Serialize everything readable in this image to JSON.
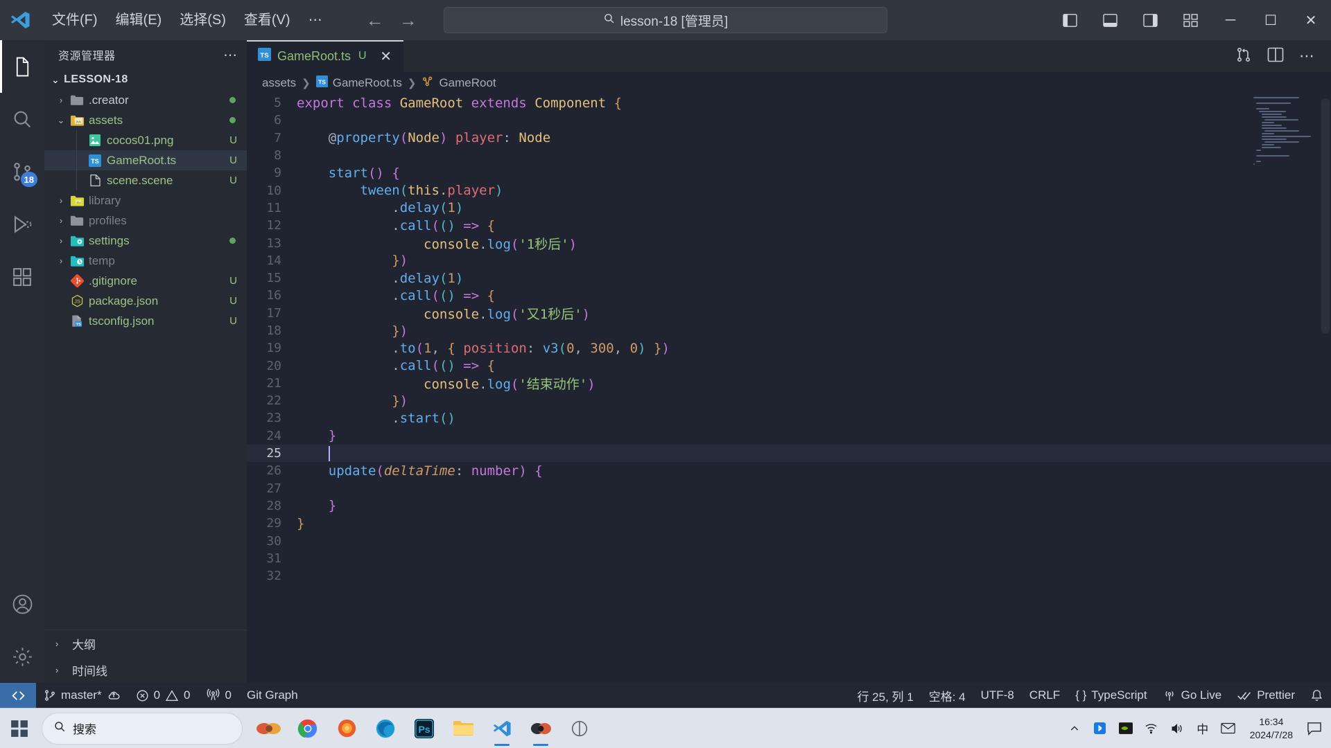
{
  "titlebar": {
    "menus": [
      "文件(F)",
      "编辑(E)",
      "选择(S)",
      "查看(V)",
      "⋯"
    ],
    "back_icon": "←",
    "forward_icon": "→",
    "command_center_text": "lesson-18 [管理员]",
    "search_icon": "search-icon",
    "minimize": "─",
    "maximize": "☐",
    "close": "✕"
  },
  "activitybar": {
    "items": [
      {
        "name": "explorer",
        "icon": "files-icon",
        "active": true,
        "badge": ""
      },
      {
        "name": "search",
        "icon": "search-icon",
        "active": false,
        "badge": ""
      },
      {
        "name": "source-control",
        "icon": "source-control-icon",
        "active": false,
        "badge": "18"
      },
      {
        "name": "run-and-debug",
        "icon": "run-debug-icon",
        "active": false,
        "badge": ""
      },
      {
        "name": "extensions",
        "icon": "extensions-icon",
        "active": false,
        "badge": ""
      }
    ],
    "bottom": [
      {
        "name": "accounts",
        "icon": "account-icon"
      },
      {
        "name": "manage",
        "icon": "gear-icon"
      }
    ]
  },
  "sidebar": {
    "title": "资源管理器",
    "actions_icon": "⋯",
    "root_label": "LESSON-18",
    "root_twisty": "⌄",
    "tree": [
      {
        "label": ".creator",
        "icon": "folder-plain",
        "twisty": "›",
        "depth": 1,
        "badge": "",
        "dot": true,
        "dim": false,
        "selected": false,
        "color": "#c7cbd2"
      },
      {
        "label": "assets",
        "icon": "folder-assets",
        "twisty": "⌄",
        "depth": 1,
        "badge": "",
        "dot": true,
        "dim": false,
        "selected": false,
        "color": "#9ec287"
      },
      {
        "label": "cocos01.png",
        "icon": "file-image",
        "twisty": "",
        "depth": 2,
        "badge": "U",
        "dot": false,
        "dim": false,
        "selected": false,
        "color": "#9ec287"
      },
      {
        "label": "GameRoot.ts",
        "icon": "file-ts",
        "twisty": "",
        "depth": 2,
        "badge": "U",
        "dot": false,
        "dim": false,
        "selected": true,
        "color": "#9ec287"
      },
      {
        "label": "scene.scene",
        "icon": "file-plain",
        "twisty": "",
        "depth": 2,
        "badge": "U",
        "dot": false,
        "dim": false,
        "selected": false,
        "color": "#9ec287"
      },
      {
        "label": "library",
        "icon": "folder-yellow",
        "twisty": "›",
        "depth": 1,
        "badge": "",
        "dot": false,
        "dim": true,
        "selected": false,
        "color": "#7d828a"
      },
      {
        "label": "profiles",
        "icon": "folder-plain",
        "twisty": "›",
        "depth": 1,
        "badge": "",
        "dot": false,
        "dim": true,
        "selected": false,
        "color": "#7d828a"
      },
      {
        "label": "settings",
        "icon": "folder-gear",
        "twisty": "›",
        "depth": 1,
        "badge": "",
        "dot": true,
        "dim": false,
        "selected": false,
        "color": "#9ec287"
      },
      {
        "label": "temp",
        "icon": "folder-clock",
        "twisty": "›",
        "depth": 1,
        "badge": "",
        "dot": false,
        "dim": true,
        "selected": false,
        "color": "#7d828a"
      },
      {
        "label": ".gitignore",
        "icon": "file-git",
        "twisty": "",
        "depth": 1,
        "badge": "U",
        "dot": false,
        "dim": false,
        "selected": false,
        "color": "#9ec287"
      },
      {
        "label": "package.json",
        "icon": "file-js",
        "twisty": "",
        "depth": 1,
        "badge": "U",
        "dot": false,
        "dim": false,
        "selected": false,
        "color": "#9ec287"
      },
      {
        "label": "tsconfig.json",
        "icon": "file-tsconfig",
        "twisty": "",
        "depth": 1,
        "badge": "U",
        "dot": false,
        "dim": false,
        "selected": false,
        "color": "#9ec287"
      }
    ],
    "panels": [
      {
        "label": "大纲",
        "twisty": "›"
      },
      {
        "label": "时间线",
        "twisty": "›"
      }
    ]
  },
  "editor": {
    "tab": {
      "icon": "file-ts",
      "label": "GameRoot.ts",
      "badge": "U",
      "close": "✕"
    },
    "tab_actions": [
      "split-compare-icon",
      "split-editor-icon",
      "more-actions-icon"
    ],
    "breadcrumbs": [
      {
        "label": "assets",
        "icon": ""
      },
      {
        "label": "GameRoot.ts",
        "icon": "file-ts"
      },
      {
        "label": "GameRoot",
        "icon": "class-icon"
      }
    ],
    "first_line_number": 5,
    "current_line": 25,
    "lines": [
      {
        "n": 5,
        "tokens": [
          {
            "t": "export ",
            "c": "t-kw"
          },
          {
            "t": "class ",
            "c": "t-kw"
          },
          {
            "t": "GameRoot ",
            "c": "t-type"
          },
          {
            "t": "extends ",
            "c": "t-kw"
          },
          {
            "t": "Component ",
            "c": "t-type"
          },
          {
            "t": "{",
            "c": "t-paren3"
          }
        ],
        "indent": 0
      },
      {
        "n": 6,
        "tokens": [],
        "indent": 0
      },
      {
        "n": 7,
        "tokens": [
          {
            "t": "@",
            "c": "t-deco"
          },
          {
            "t": "property",
            "c": "t-fn"
          },
          {
            "t": "(",
            "c": "t-paren2"
          },
          {
            "t": "Node",
            "c": "t-type"
          },
          {
            "t": ")",
            "c": "t-paren2"
          },
          {
            "t": " ",
            "c": "t-plain"
          },
          {
            "t": "player",
            "c": "t-prop"
          },
          {
            "t": ": ",
            "c": "t-plain"
          },
          {
            "t": "Node",
            "c": "t-type"
          }
        ],
        "indent": 1
      },
      {
        "n": 8,
        "tokens": [],
        "indent": 1
      },
      {
        "n": 9,
        "tokens": [
          {
            "t": "start",
            "c": "t-fn"
          },
          {
            "t": "()",
            "c": "t-paren2"
          },
          {
            "t": " ",
            "c": "t-plain"
          },
          {
            "t": "{",
            "c": "t-paren2"
          }
        ],
        "indent": 1
      },
      {
        "n": 10,
        "tokens": [
          {
            "t": "tween",
            "c": "t-fn"
          },
          {
            "t": "(",
            "c": "t-paren"
          },
          {
            "t": "this",
            "c": "t-var"
          },
          {
            "t": ".",
            "c": "t-plain"
          },
          {
            "t": "player",
            "c": "t-prop"
          },
          {
            "t": ")",
            "c": "t-paren"
          }
        ],
        "indent": 2
      },
      {
        "n": 11,
        "tokens": [
          {
            "t": ".",
            "c": "t-plain"
          },
          {
            "t": "delay",
            "c": "t-fn"
          },
          {
            "t": "(",
            "c": "t-paren"
          },
          {
            "t": "1",
            "c": "t-num"
          },
          {
            "t": ")",
            "c": "t-paren"
          }
        ],
        "indent": 3
      },
      {
        "n": 12,
        "tokens": [
          {
            "t": ".",
            "c": "t-plain"
          },
          {
            "t": "call",
            "c": "t-fn"
          },
          {
            "t": "(",
            "c": "t-paren2"
          },
          {
            "t": "()",
            "c": "t-paren"
          },
          {
            "t": " ",
            "c": "t-plain"
          },
          {
            "t": "=>",
            "c": "t-arrow"
          },
          {
            "t": " ",
            "c": "t-plain"
          },
          {
            "t": "{",
            "c": "t-paren3"
          }
        ],
        "indent": 3
      },
      {
        "n": 13,
        "tokens": [
          {
            "t": "console",
            "c": "t-type"
          },
          {
            "t": ".",
            "c": "t-plain"
          },
          {
            "t": "log",
            "c": "t-fn"
          },
          {
            "t": "(",
            "c": "t-paren2"
          },
          {
            "t": "'1秒后'",
            "c": "t-str"
          },
          {
            "t": ")",
            "c": "t-paren2"
          }
        ],
        "indent": 4
      },
      {
        "n": 14,
        "tokens": [
          {
            "t": "}",
            "c": "t-paren3"
          },
          {
            "t": ")",
            "c": "t-paren2"
          }
        ],
        "indent": 3
      },
      {
        "n": 15,
        "tokens": [
          {
            "t": ".",
            "c": "t-plain"
          },
          {
            "t": "delay",
            "c": "t-fn"
          },
          {
            "t": "(",
            "c": "t-paren"
          },
          {
            "t": "1",
            "c": "t-num"
          },
          {
            "t": ")",
            "c": "t-paren"
          }
        ],
        "indent": 3
      },
      {
        "n": 16,
        "tokens": [
          {
            "t": ".",
            "c": "t-plain"
          },
          {
            "t": "call",
            "c": "t-fn"
          },
          {
            "t": "(",
            "c": "t-paren2"
          },
          {
            "t": "()",
            "c": "t-paren"
          },
          {
            "t": " ",
            "c": "t-plain"
          },
          {
            "t": "=>",
            "c": "t-arrow"
          },
          {
            "t": " ",
            "c": "t-plain"
          },
          {
            "t": "{",
            "c": "t-paren3"
          }
        ],
        "indent": 3
      },
      {
        "n": 17,
        "tokens": [
          {
            "t": "console",
            "c": "t-type"
          },
          {
            "t": ".",
            "c": "t-plain"
          },
          {
            "t": "log",
            "c": "t-fn"
          },
          {
            "t": "(",
            "c": "t-paren2"
          },
          {
            "t": "'又1秒后'",
            "c": "t-str"
          },
          {
            "t": ")",
            "c": "t-paren2"
          }
        ],
        "indent": 4
      },
      {
        "n": 18,
        "tokens": [
          {
            "t": "}",
            "c": "t-paren3"
          },
          {
            "t": ")",
            "c": "t-paren2"
          }
        ],
        "indent": 3
      },
      {
        "n": 19,
        "tokens": [
          {
            "t": ".",
            "c": "t-plain"
          },
          {
            "t": "to",
            "c": "t-fn"
          },
          {
            "t": "(",
            "c": "t-paren2"
          },
          {
            "t": "1",
            "c": "t-num"
          },
          {
            "t": ", ",
            "c": "t-plain"
          },
          {
            "t": "{",
            "c": "t-paren3"
          },
          {
            "t": " ",
            "c": "t-plain"
          },
          {
            "t": "position",
            "c": "t-prop"
          },
          {
            "t": ": ",
            "c": "t-plain"
          },
          {
            "t": "v3",
            "c": "t-fn"
          },
          {
            "t": "(",
            "c": "t-paren"
          },
          {
            "t": "0",
            "c": "t-num"
          },
          {
            "t": ", ",
            "c": "t-plain"
          },
          {
            "t": "300",
            "c": "t-num"
          },
          {
            "t": ", ",
            "c": "t-plain"
          },
          {
            "t": "0",
            "c": "t-num"
          },
          {
            "t": ")",
            "c": "t-paren"
          },
          {
            "t": " ",
            "c": "t-plain"
          },
          {
            "t": "}",
            "c": "t-paren3"
          },
          {
            "t": ")",
            "c": "t-paren2"
          }
        ],
        "indent": 3
      },
      {
        "n": 20,
        "tokens": [
          {
            "t": ".",
            "c": "t-plain"
          },
          {
            "t": "call",
            "c": "t-fn"
          },
          {
            "t": "(",
            "c": "t-paren2"
          },
          {
            "t": "()",
            "c": "t-paren"
          },
          {
            "t": " ",
            "c": "t-plain"
          },
          {
            "t": "=>",
            "c": "t-arrow"
          },
          {
            "t": " ",
            "c": "t-plain"
          },
          {
            "t": "{",
            "c": "t-paren3"
          }
        ],
        "indent": 3
      },
      {
        "n": 21,
        "tokens": [
          {
            "t": "console",
            "c": "t-type"
          },
          {
            "t": ".",
            "c": "t-plain"
          },
          {
            "t": "log",
            "c": "t-fn"
          },
          {
            "t": "(",
            "c": "t-paren2"
          },
          {
            "t": "'结束动作'",
            "c": "t-str"
          },
          {
            "t": ")",
            "c": "t-paren2"
          }
        ],
        "indent": 4
      },
      {
        "n": 22,
        "tokens": [
          {
            "t": "}",
            "c": "t-paren3"
          },
          {
            "t": ")",
            "c": "t-paren2"
          }
        ],
        "indent": 3
      },
      {
        "n": 23,
        "tokens": [
          {
            "t": ".",
            "c": "t-plain"
          },
          {
            "t": "start",
            "c": "t-fn"
          },
          {
            "t": "()",
            "c": "t-paren"
          }
        ],
        "indent": 3
      },
      {
        "n": 24,
        "tokens": [
          {
            "t": "}",
            "c": "t-paren2"
          }
        ],
        "indent": 1
      },
      {
        "n": 25,
        "tokens": [],
        "indent": 1,
        "caret": true
      },
      {
        "n": 26,
        "tokens": [
          {
            "t": "update",
            "c": "t-fn"
          },
          {
            "t": "(",
            "c": "t-paren2"
          },
          {
            "t": "deltaTime",
            "c": "t-param"
          },
          {
            "t": ": ",
            "c": "t-plain"
          },
          {
            "t": "number",
            "c": "t-type-kw"
          },
          {
            "t": ")",
            "c": "t-paren2"
          },
          {
            "t": " ",
            "c": "t-plain"
          },
          {
            "t": "{",
            "c": "t-paren2"
          }
        ],
        "indent": 1
      },
      {
        "n": 27,
        "tokens": [],
        "indent": 1
      },
      {
        "n": 28,
        "tokens": [
          {
            "t": "}",
            "c": "t-paren2"
          }
        ],
        "indent": 1
      },
      {
        "n": 29,
        "tokens": [
          {
            "t": "}",
            "c": "t-paren3"
          }
        ],
        "indent": 0
      },
      {
        "n": 30,
        "tokens": [],
        "indent": 0
      },
      {
        "n": 31,
        "tokens": [],
        "indent": 0
      },
      {
        "n": 32,
        "tokens": [],
        "indent": 0
      }
    ]
  },
  "statusbar": {
    "remote_icon": "remote-window-icon",
    "left": [
      {
        "name": "branch",
        "icon": "source-control-icon",
        "label": "master*",
        "suffix_icon": "sync-cloud-icon"
      },
      {
        "name": "problems",
        "icon": "error-icon",
        "label": "0",
        "icon2": "warning-icon",
        "label2": "0"
      },
      {
        "name": "ports",
        "icon": "radio-tower-icon",
        "label": "0"
      },
      {
        "name": "git-graph",
        "icon": "",
        "label": "Git Graph"
      }
    ],
    "right": [
      {
        "name": "cursor-position",
        "label": "行 25, 列 1"
      },
      {
        "name": "indentation",
        "label": "空格: 4"
      },
      {
        "name": "encoding",
        "label": "UTF-8"
      },
      {
        "name": "eol",
        "label": "CRLF"
      },
      {
        "name": "language-mode",
        "icon": "braces-icon",
        "label": "TypeScript"
      },
      {
        "name": "go-live",
        "icon": "broadcast-icon",
        "label": "Go Live"
      },
      {
        "name": "prettier",
        "icon": "checks-icon",
        "label": "Prettier"
      },
      {
        "name": "notifications",
        "icon": "bell-icon",
        "label": ""
      }
    ]
  },
  "taskbar": {
    "start_icon": "windows-start-icon",
    "search_placeholder": "搜索",
    "search_icon": "search-icon",
    "apps": [
      {
        "name": "cocos-creator",
        "active": false
      },
      {
        "name": "paint-3d",
        "active": false
      },
      {
        "name": "google-chrome",
        "active": false
      },
      {
        "name": "firefox",
        "active": false
      },
      {
        "name": "microsoft-edge",
        "active": false
      },
      {
        "name": "photoshop",
        "active": false
      },
      {
        "name": "file-explorer",
        "active": false
      },
      {
        "name": "vscode",
        "active": true
      },
      {
        "name": "cocos-dashboard",
        "active": true
      },
      {
        "name": "other-app",
        "active": false
      }
    ],
    "tray": [
      "chevron-up-icon",
      "bluetooth-icon",
      "nvidia-icon",
      "wifi-icon",
      "volume-icon",
      "ime-chinese-icon",
      "mail-icon"
    ],
    "clock_time": "16:34",
    "clock_date": "2024/7/28",
    "action-center-icon": "speech-bubble-icon"
  }
}
